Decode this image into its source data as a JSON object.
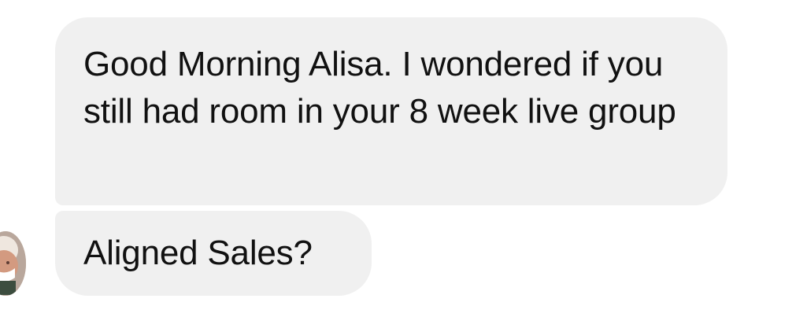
{
  "conversation": {
    "messages": [
      {
        "text": "Good Morning Alisa. I wondered if you still had room in your 8 week live group"
      },
      {
        "text": "Aligned Sales?"
      }
    ]
  },
  "avatar": {
    "icon": "profile-photo"
  },
  "colors": {
    "background": "#ffffff",
    "bubble": "#f0f0f0",
    "text": "#111111"
  }
}
